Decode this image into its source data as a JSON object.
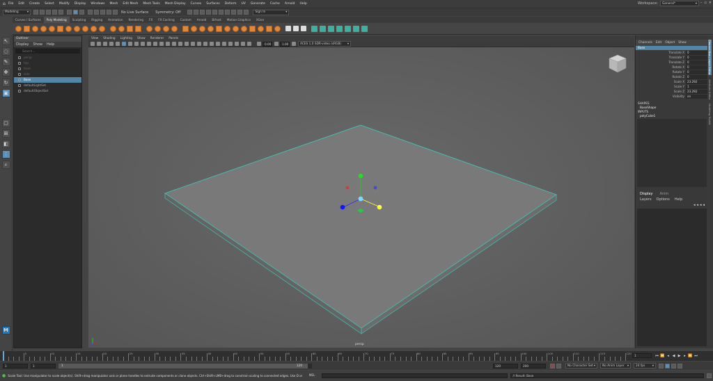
{
  "menubar": {
    "items": [
      "File",
      "Edit",
      "Create",
      "Select",
      "Modify",
      "Display",
      "Windows",
      "Mesh",
      "Edit Mesh",
      "Mesh Tools",
      "Mesh Display",
      "Curves",
      "Surfaces",
      "Deform",
      "UV",
      "Generate",
      "Cache",
      "Arnold",
      "Help"
    ],
    "workspace_label": "Workspace:",
    "workspace_value": "General*"
  },
  "statusline": {
    "mode": "Modeling",
    "live_surface": "No Live Surface",
    "symmetry": "Symmetry: Off",
    "sign_in": "Sign In"
  },
  "shelf": {
    "tabs": [
      "Curves / Surfaces",
      "Poly Modeling",
      "Sculpting",
      "Rigging",
      "Animation",
      "Rendering",
      "FX",
      "FX Caching",
      "Custom",
      "Arnold",
      "Bifrost",
      "Motion Graphics",
      "XGen"
    ],
    "active_tab": 1
  },
  "outliner": {
    "title": "Outliner",
    "menus": [
      "Display",
      "Show",
      "Help"
    ],
    "search_placeholder": "Search...",
    "items": [
      {
        "label": "persp",
        "dim": true,
        "selected": false
      },
      {
        "label": "top",
        "dim": true,
        "selected": false
      },
      {
        "label": "front",
        "dim": true,
        "selected": false
      },
      {
        "label": "side",
        "dim": true,
        "selected": false
      },
      {
        "label": "Base",
        "dim": false,
        "selected": true
      },
      {
        "label": "defaultLightSet",
        "dim": false,
        "selected": false
      },
      {
        "label": "defaultObjectSet",
        "dim": false,
        "selected": false
      }
    ]
  },
  "viewport": {
    "menus": [
      "View",
      "Shading",
      "Lighting",
      "Show",
      "Renderer",
      "Panels"
    ],
    "near": "0.00",
    "far": "1.00",
    "colorspace": "ACES 1.0 SDR-video (sRGB)",
    "camera_label": "persp"
  },
  "channelbox": {
    "tabs": [
      "Channels",
      "Edit",
      "Object",
      "Show"
    ],
    "object": "Base",
    "attributes": [
      {
        "name": "Translate X",
        "value": "0"
      },
      {
        "name": "Translate Y",
        "value": "0"
      },
      {
        "name": "Translate Z",
        "value": "0"
      },
      {
        "name": "Rotate X",
        "value": "0"
      },
      {
        "name": "Rotate Y",
        "value": "0"
      },
      {
        "name": "Rotate Z",
        "value": "0"
      },
      {
        "name": "Scale X",
        "value": "23.292"
      },
      {
        "name": "Scale Y",
        "value": "1"
      },
      {
        "name": "Scale Z",
        "value": "23.292"
      },
      {
        "name": "Visibility",
        "value": "on"
      }
    ],
    "shapes_header": "SHAPES",
    "shape": "BaseShape",
    "inputs_header": "INPUTS",
    "input": "polyCube1"
  },
  "layers": {
    "tabs": [
      "Display",
      "Anim"
    ],
    "menus": [
      "Layers",
      "Options",
      "Help"
    ]
  },
  "sidebar": {
    "labels": [
      "Channel Box / Layer Editor",
      "Attribute Editor",
      "Modeling Toolkit"
    ]
  },
  "timeline": {
    "ticks": [
      "5",
      "10",
      "15",
      "20",
      "25",
      "30",
      "35",
      "40",
      "45",
      "50",
      "55",
      "60",
      "65",
      "70",
      "75",
      "80",
      "85",
      "90",
      "95",
      "100",
      "105",
      "110",
      "115",
      "120"
    ],
    "current_frame": "1"
  },
  "range": {
    "start": "1",
    "start_inner": "1",
    "range_start_label": "1",
    "range_end_label": "120",
    "end_inner": "120",
    "end": "200",
    "character_set": "No Character Set",
    "anim_layer": "No Anim Layer",
    "fps": "24 fps"
  },
  "cmdline": {
    "help": "Scale Tool: Use manipulator to scale object(s). Shift+drag manipulator axis or plane handles to extrude components or clone objects. Ctrl+Shift+LMB+drag to constrain scaling to connected edges. Use D or INSERT to change the pivot p",
    "lang": "MEL",
    "result": "// Result: Base"
  }
}
